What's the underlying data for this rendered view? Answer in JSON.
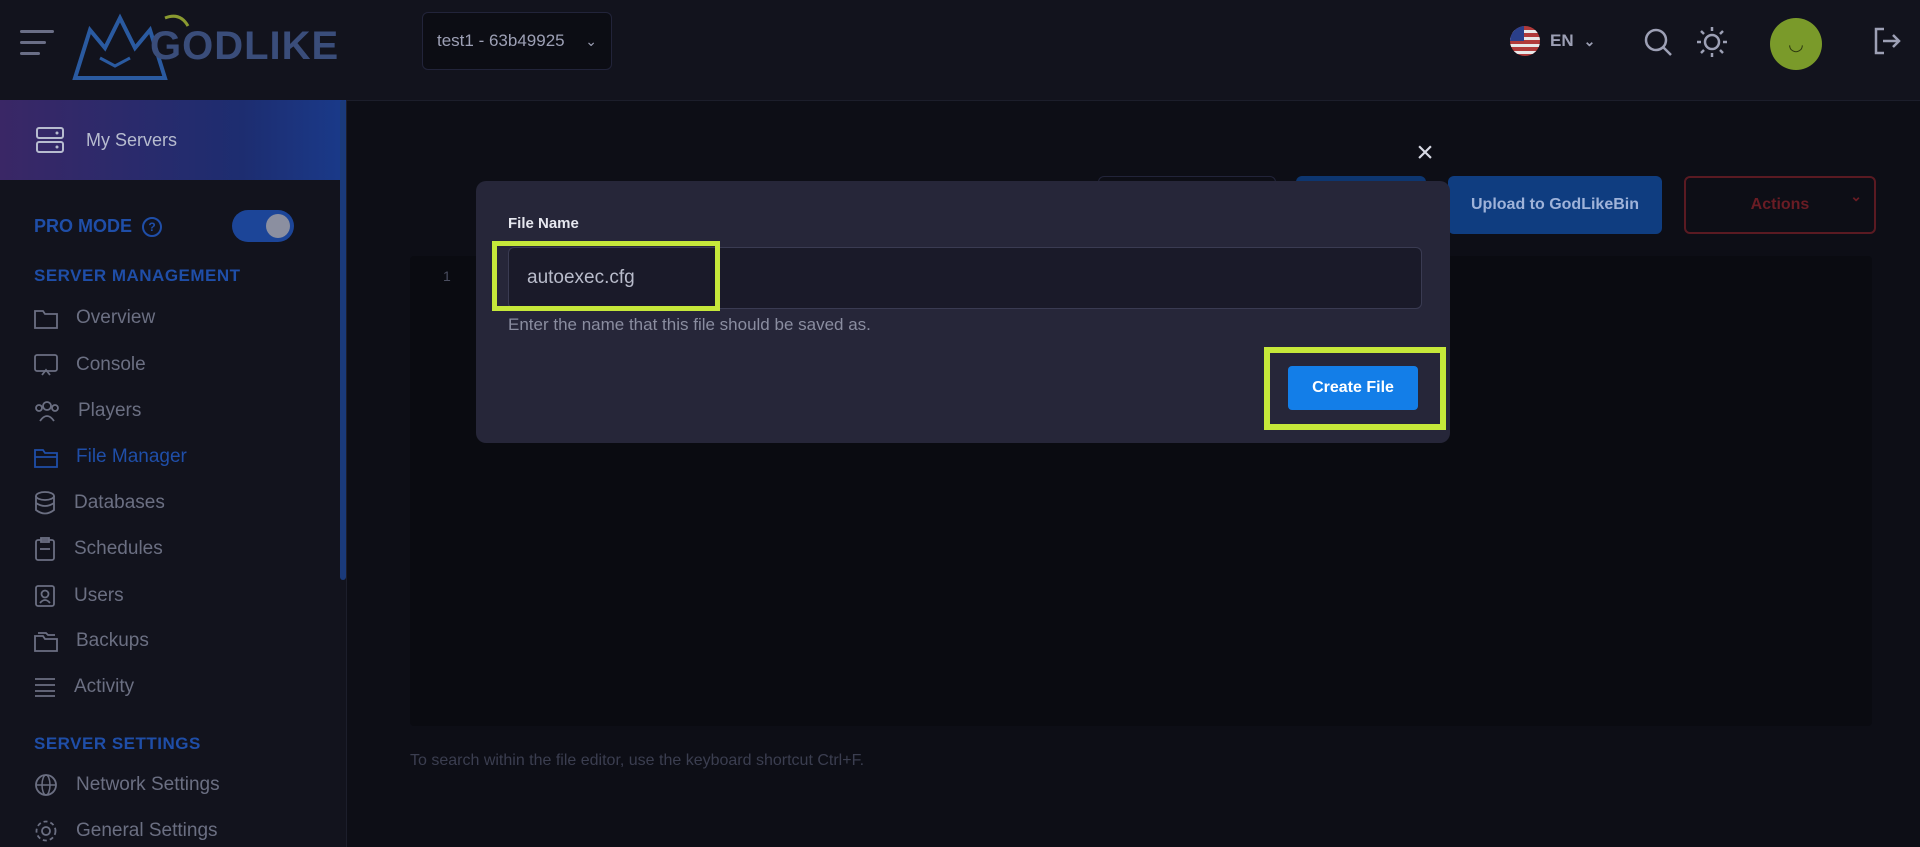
{
  "header": {
    "logo_text": "GODLIKE",
    "server_select": "test1 - 63b49925",
    "language": "EN"
  },
  "sidebar": {
    "my_servers": "My Servers",
    "pro_mode": "PRO MODE",
    "help_mark": "?",
    "server_management": "SERVER MANAGEMENT",
    "items": [
      {
        "label": "Overview",
        "icon": "folder-icon"
      },
      {
        "label": "Console",
        "icon": "console-icon"
      },
      {
        "label": "Players",
        "icon": "players-icon"
      },
      {
        "label": "File Manager",
        "icon": "folder-open-icon",
        "active": true
      },
      {
        "label": "Databases",
        "icon": "database-icon"
      },
      {
        "label": "Schedules",
        "icon": "clipboard-icon"
      },
      {
        "label": "Users",
        "icon": "user-badge-icon"
      },
      {
        "label": "Backups",
        "icon": "folder-stack-icon"
      },
      {
        "label": "Activity",
        "icon": "list-icon"
      }
    ],
    "server_settings": "SERVER SETTINGS",
    "settings_items": [
      {
        "label": "Network Settings",
        "icon": "globe-icon"
      },
      {
        "label": "General Settings",
        "icon": "gear-icon"
      }
    ]
  },
  "main": {
    "upload_label": "Upload to GodLikeBin",
    "actions_label": "Actions",
    "line_number": "1",
    "hint": "To search within the file editor, use the keyboard shortcut Ctrl+F."
  },
  "modal": {
    "close": "×",
    "field_label": "File Name",
    "file_name_value": "autoexec.cfg",
    "help_text": "Enter the name that this file should be saved as.",
    "create_label": "Create File"
  },
  "colors": {
    "highlight": "#c6e83a",
    "primary_button": "#137ee8",
    "accent_blue": "#1f4ea8"
  }
}
